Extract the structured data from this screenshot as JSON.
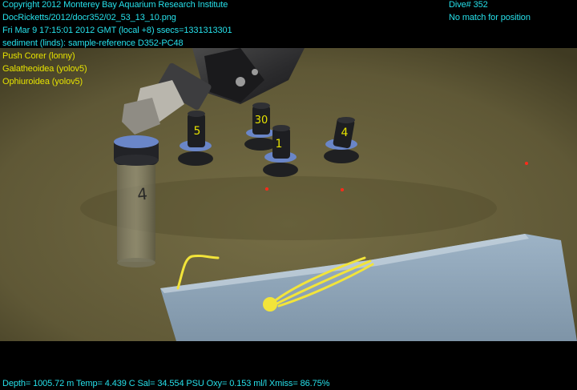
{
  "overlay": {
    "header_lines": [
      "Copyright 2012 Monterey Bay Aquarium Research Institute",
      "DocRicketts/2012/docr352/02_53_13_10.png",
      "Fri Mar  9 17:15:01 2012 GMT (local +8)  ssecs=1331313301",
      "sediment (linds): sample-reference D352-PC48"
    ],
    "annotation_lines": [
      "Push Corer (lonny)",
      "Galatheoidea (yolov5)",
      "Ophiuroidea (yolov5)"
    ],
    "dive": "Dive# 352",
    "position_status": "No match for position",
    "telemetry": "Depth= 1005.72 m  Temp= 4.439 C  Sal= 34.554 PSU  Oxy= 0.153 ml/l  Xmiss= 86.75%"
  },
  "scene": {
    "core_labels": [
      "4",
      "5",
      "30",
      "1",
      "4"
    ]
  },
  "colors": {
    "overlay_text": "#26e0ea",
    "annotation_text": "#e6e200",
    "seafloor": "#6f6741"
  }
}
